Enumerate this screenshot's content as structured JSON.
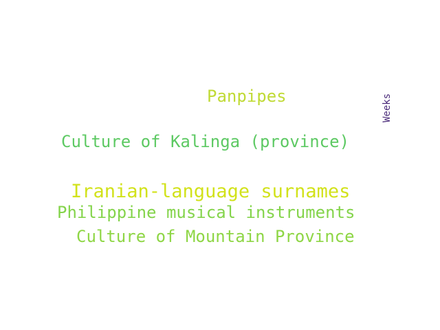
{
  "word_cloud": {
    "words": [
      {
        "text": "Panpipes",
        "color": "#c0da35"
      },
      {
        "text": "Culture of Kalinga (province)",
        "color": "#5dc963"
      },
      {
        "text": "Iranian-language surnames",
        "color": "#d2e21b"
      },
      {
        "text": "Philippine musical instruments",
        "color": "#84d44b"
      },
      {
        "text": "Culture of Mountain Province",
        "color": "#8ed645"
      },
      {
        "text": "Weeks",
        "color": "#482878",
        "orientation": "vertical"
      }
    ]
  }
}
